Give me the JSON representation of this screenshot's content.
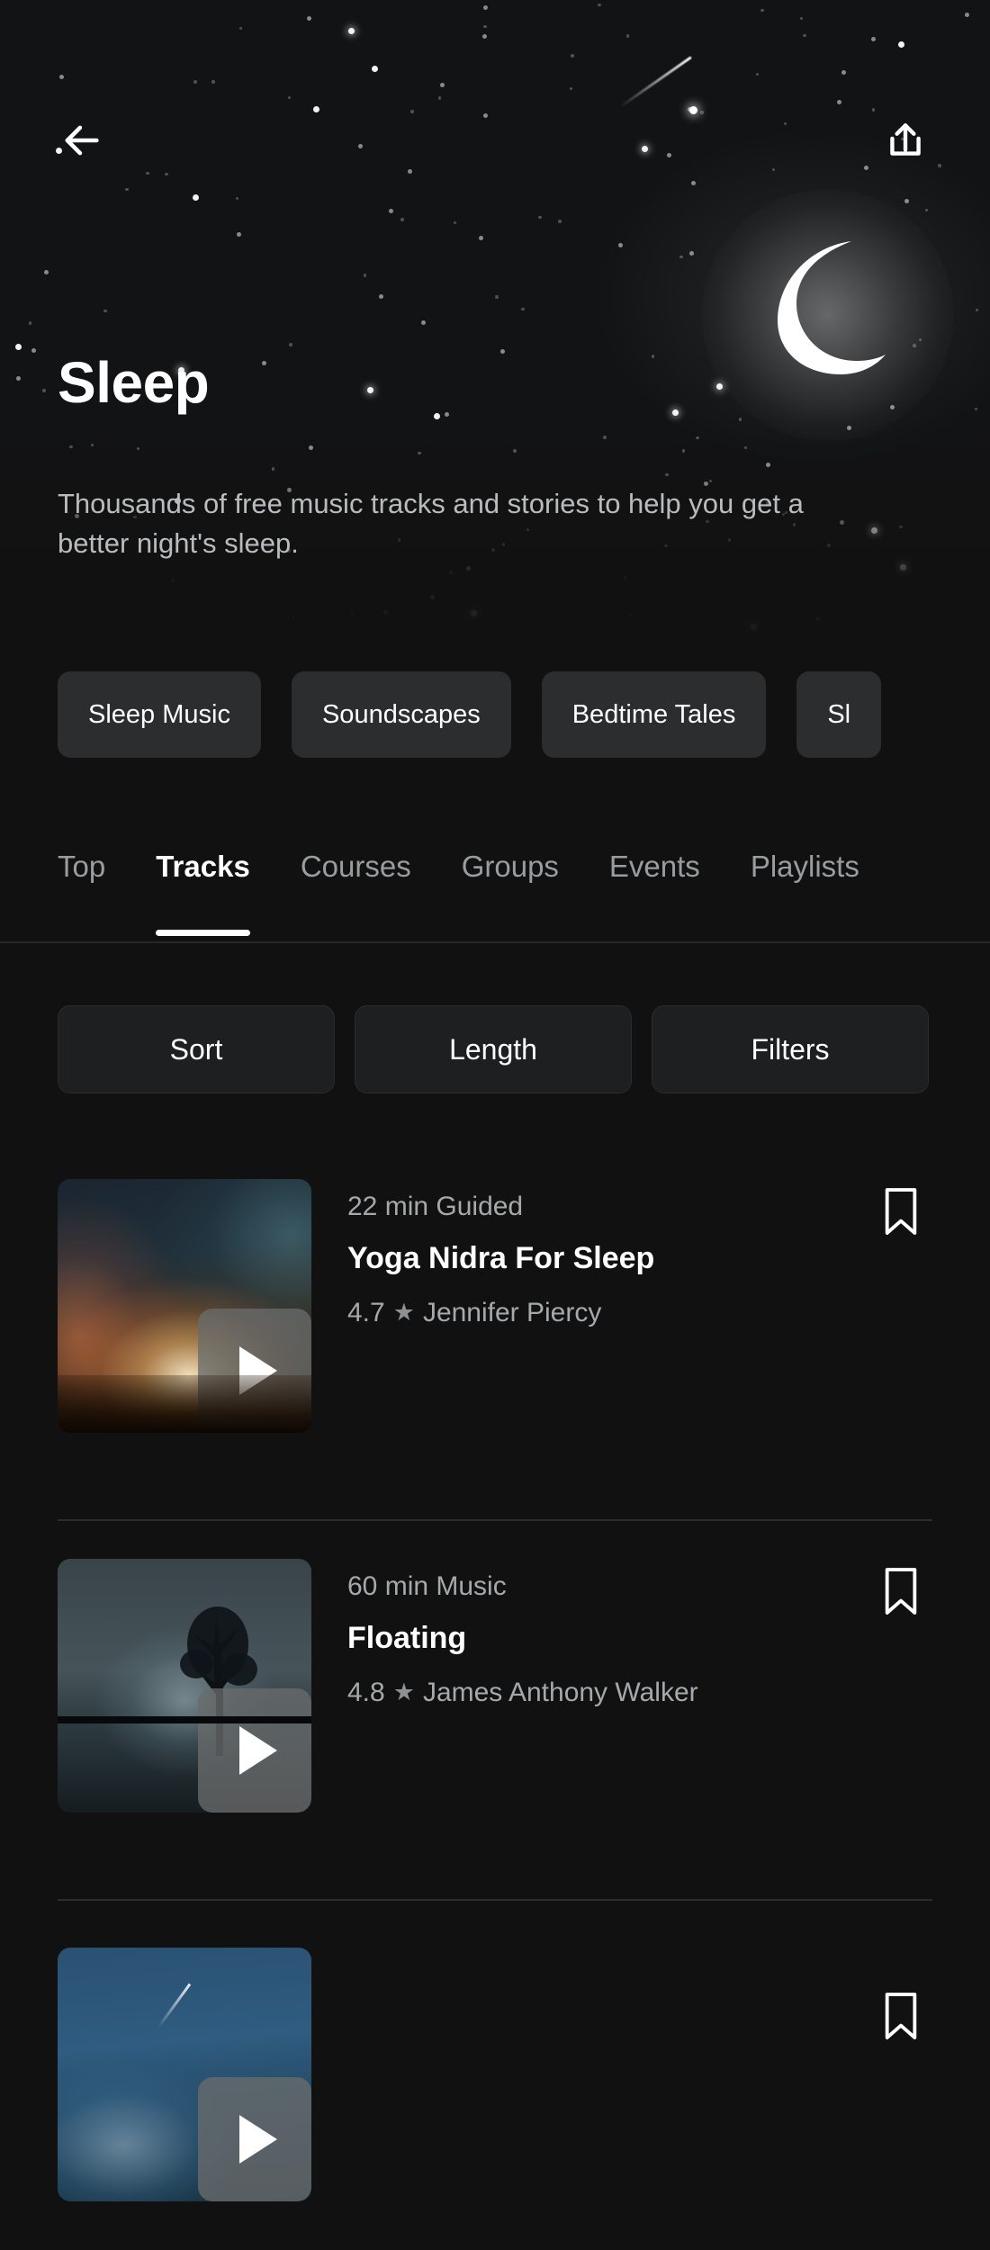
{
  "header": {
    "back_icon": "arrow-left-icon",
    "share_icon": "share-upload-icon",
    "moon_icon": "crescent-moon-icon",
    "title": "Sleep",
    "subtitle": "Thousands of free music tracks and stories to help you get a better night's sleep."
  },
  "categories": [
    {
      "label": "Sleep Music"
    },
    {
      "label": "Soundscapes"
    },
    {
      "label": "Bedtime Tales"
    },
    {
      "label": "Sl"
    }
  ],
  "tabs": [
    {
      "label": "Top",
      "active": false
    },
    {
      "label": "Tracks",
      "active": true
    },
    {
      "label": "Courses",
      "active": false
    },
    {
      "label": "Groups",
      "active": false
    },
    {
      "label": "Events",
      "active": false
    },
    {
      "label": "Playlists",
      "active": false
    }
  ],
  "filters": [
    {
      "label": "Sort"
    },
    {
      "label": "Length"
    },
    {
      "label": "Filters"
    }
  ],
  "tracks": [
    {
      "duration": "22 min Guided",
      "title": "Yoga Nidra For Sleep",
      "rating": "4.7",
      "star": "★",
      "author": "Jennifer Piercy",
      "play_icon": "play-icon",
      "bookmark_icon": "bookmark-icon"
    },
    {
      "duration": "60 min Music",
      "title": "Floating",
      "rating": "4.8",
      "star": "★",
      "author": "James Anthony Walker",
      "play_icon": "play-icon",
      "bookmark_icon": "bookmark-icon"
    }
  ],
  "colors": {
    "background": "#111111",
    "chip_background": "#2b2d2f",
    "filter_background": "#1d1f21",
    "text_primary": "#ffffff",
    "text_secondary": "#a6a9ab",
    "divider": "#2a2c2e",
    "active_underline": "#ffffff"
  }
}
